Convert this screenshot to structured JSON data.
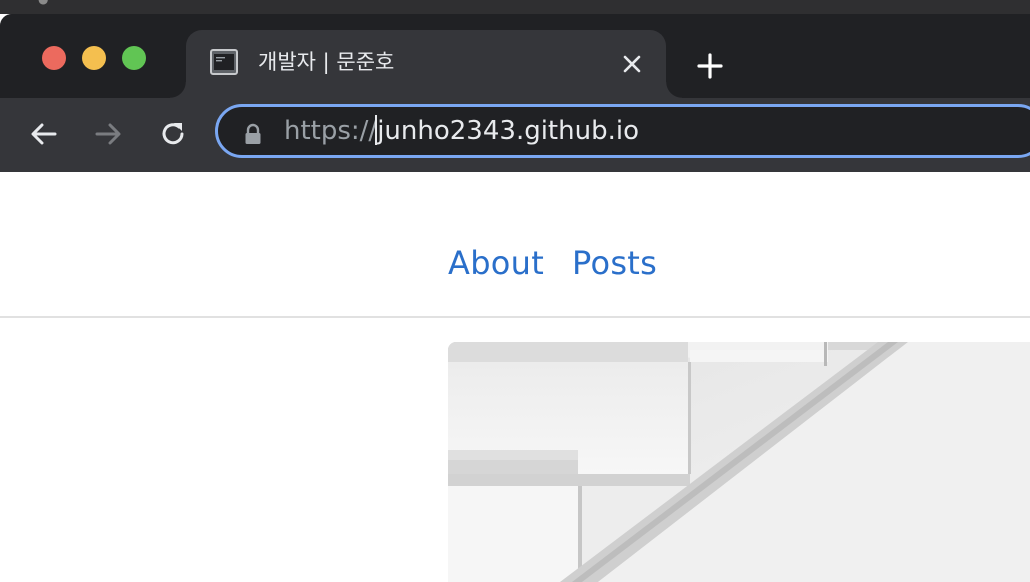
{
  "browser": {
    "window_controls": [
      "close",
      "minimize",
      "maximize"
    ],
    "tabs": [
      {
        "title": "개발자 | 문준호",
        "icon": "terminal-favicon-icon",
        "active": true
      }
    ],
    "new_tab_icon": "plus-icon",
    "toolbar": {
      "back_icon": "arrow-left-icon",
      "forward_icon": "arrow-right-icon",
      "reload_icon": "reload-icon",
      "lock_icon": "lock-icon",
      "url_scheme": "https://",
      "url_host": "junho2343.github.io"
    },
    "colors": {
      "frame": "#202124",
      "tab_active": "#35363a",
      "omnibox_focus": "#7aa7f2"
    }
  },
  "site": {
    "nav": [
      {
        "label": "About"
      },
      {
        "label": "Posts"
      }
    ],
    "link_color": "#2a6fca",
    "hero_image": "grayscale-architecture-stairs"
  }
}
